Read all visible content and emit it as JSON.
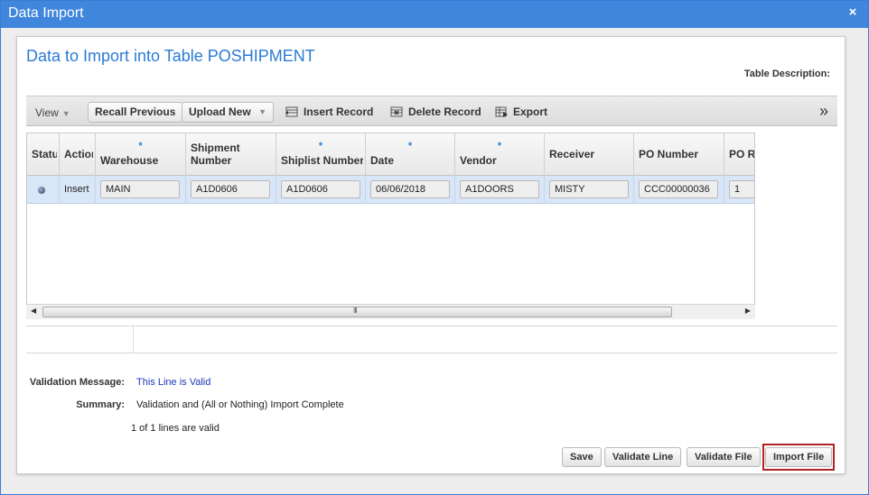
{
  "window": {
    "title": "Data Import",
    "close_glyph": "×"
  },
  "panel": {
    "title": "Data to Import into Table POSHIPMENT",
    "table_description_label": "Table Description:"
  },
  "toolbar": {
    "view_label": "View",
    "recall_previous": "Recall Previous",
    "upload_new": "Upload New",
    "insert_record": "Insert Record",
    "delete_record": "Delete Record",
    "export": "Export",
    "more_glyph": "»"
  },
  "grid": {
    "columns": [
      {
        "key": "status",
        "label": "Status",
        "required": false
      },
      {
        "key": "action",
        "label": "Action",
        "required": false
      },
      {
        "key": "warehouse",
        "label": "Warehouse",
        "required": true
      },
      {
        "key": "shipment_number",
        "label": "Shipment Number",
        "required": false
      },
      {
        "key": "shiplist_number",
        "label": "Shiplist Number",
        "required": true
      },
      {
        "key": "date",
        "label": "Date",
        "required": true
      },
      {
        "key": "vendor",
        "label": "Vendor",
        "required": true
      },
      {
        "key": "receiver",
        "label": "Receiver",
        "required": false
      },
      {
        "key": "po_number",
        "label": "PO Number",
        "required": false
      },
      {
        "key": "po_re",
        "label": "PO Re",
        "required": false
      }
    ],
    "required_marker": "*",
    "rows": [
      {
        "action": "Insert",
        "warehouse": "MAIN",
        "shipment_number": "A1D0606",
        "shiplist_number": "A1D0606",
        "date": "06/06/2018",
        "vendor": "A1DOORS",
        "receiver": "MISTY",
        "po_number": "CCC00000036",
        "po_re": "1"
      }
    ],
    "scroll_grip": "III"
  },
  "results": {
    "validation_message_label": "Validation Message:",
    "validation_message_value": "This Line is Valid",
    "summary_label": "Summary:",
    "summary_value": "Validation and (All or Nothing) Import Complete",
    "lines_valid": "1 of 1 lines are valid"
  },
  "buttons": {
    "save": "Save",
    "validate_line": "Validate Line",
    "validate_file": "Validate File",
    "import_file": "Import File"
  },
  "colors": {
    "title_bar": "#3f86dc",
    "panel_title": "#2b7bd6",
    "selected_row": "#d9e6f7",
    "validation_text": "#1a35b8",
    "highlight_outline": "#b22222"
  }
}
